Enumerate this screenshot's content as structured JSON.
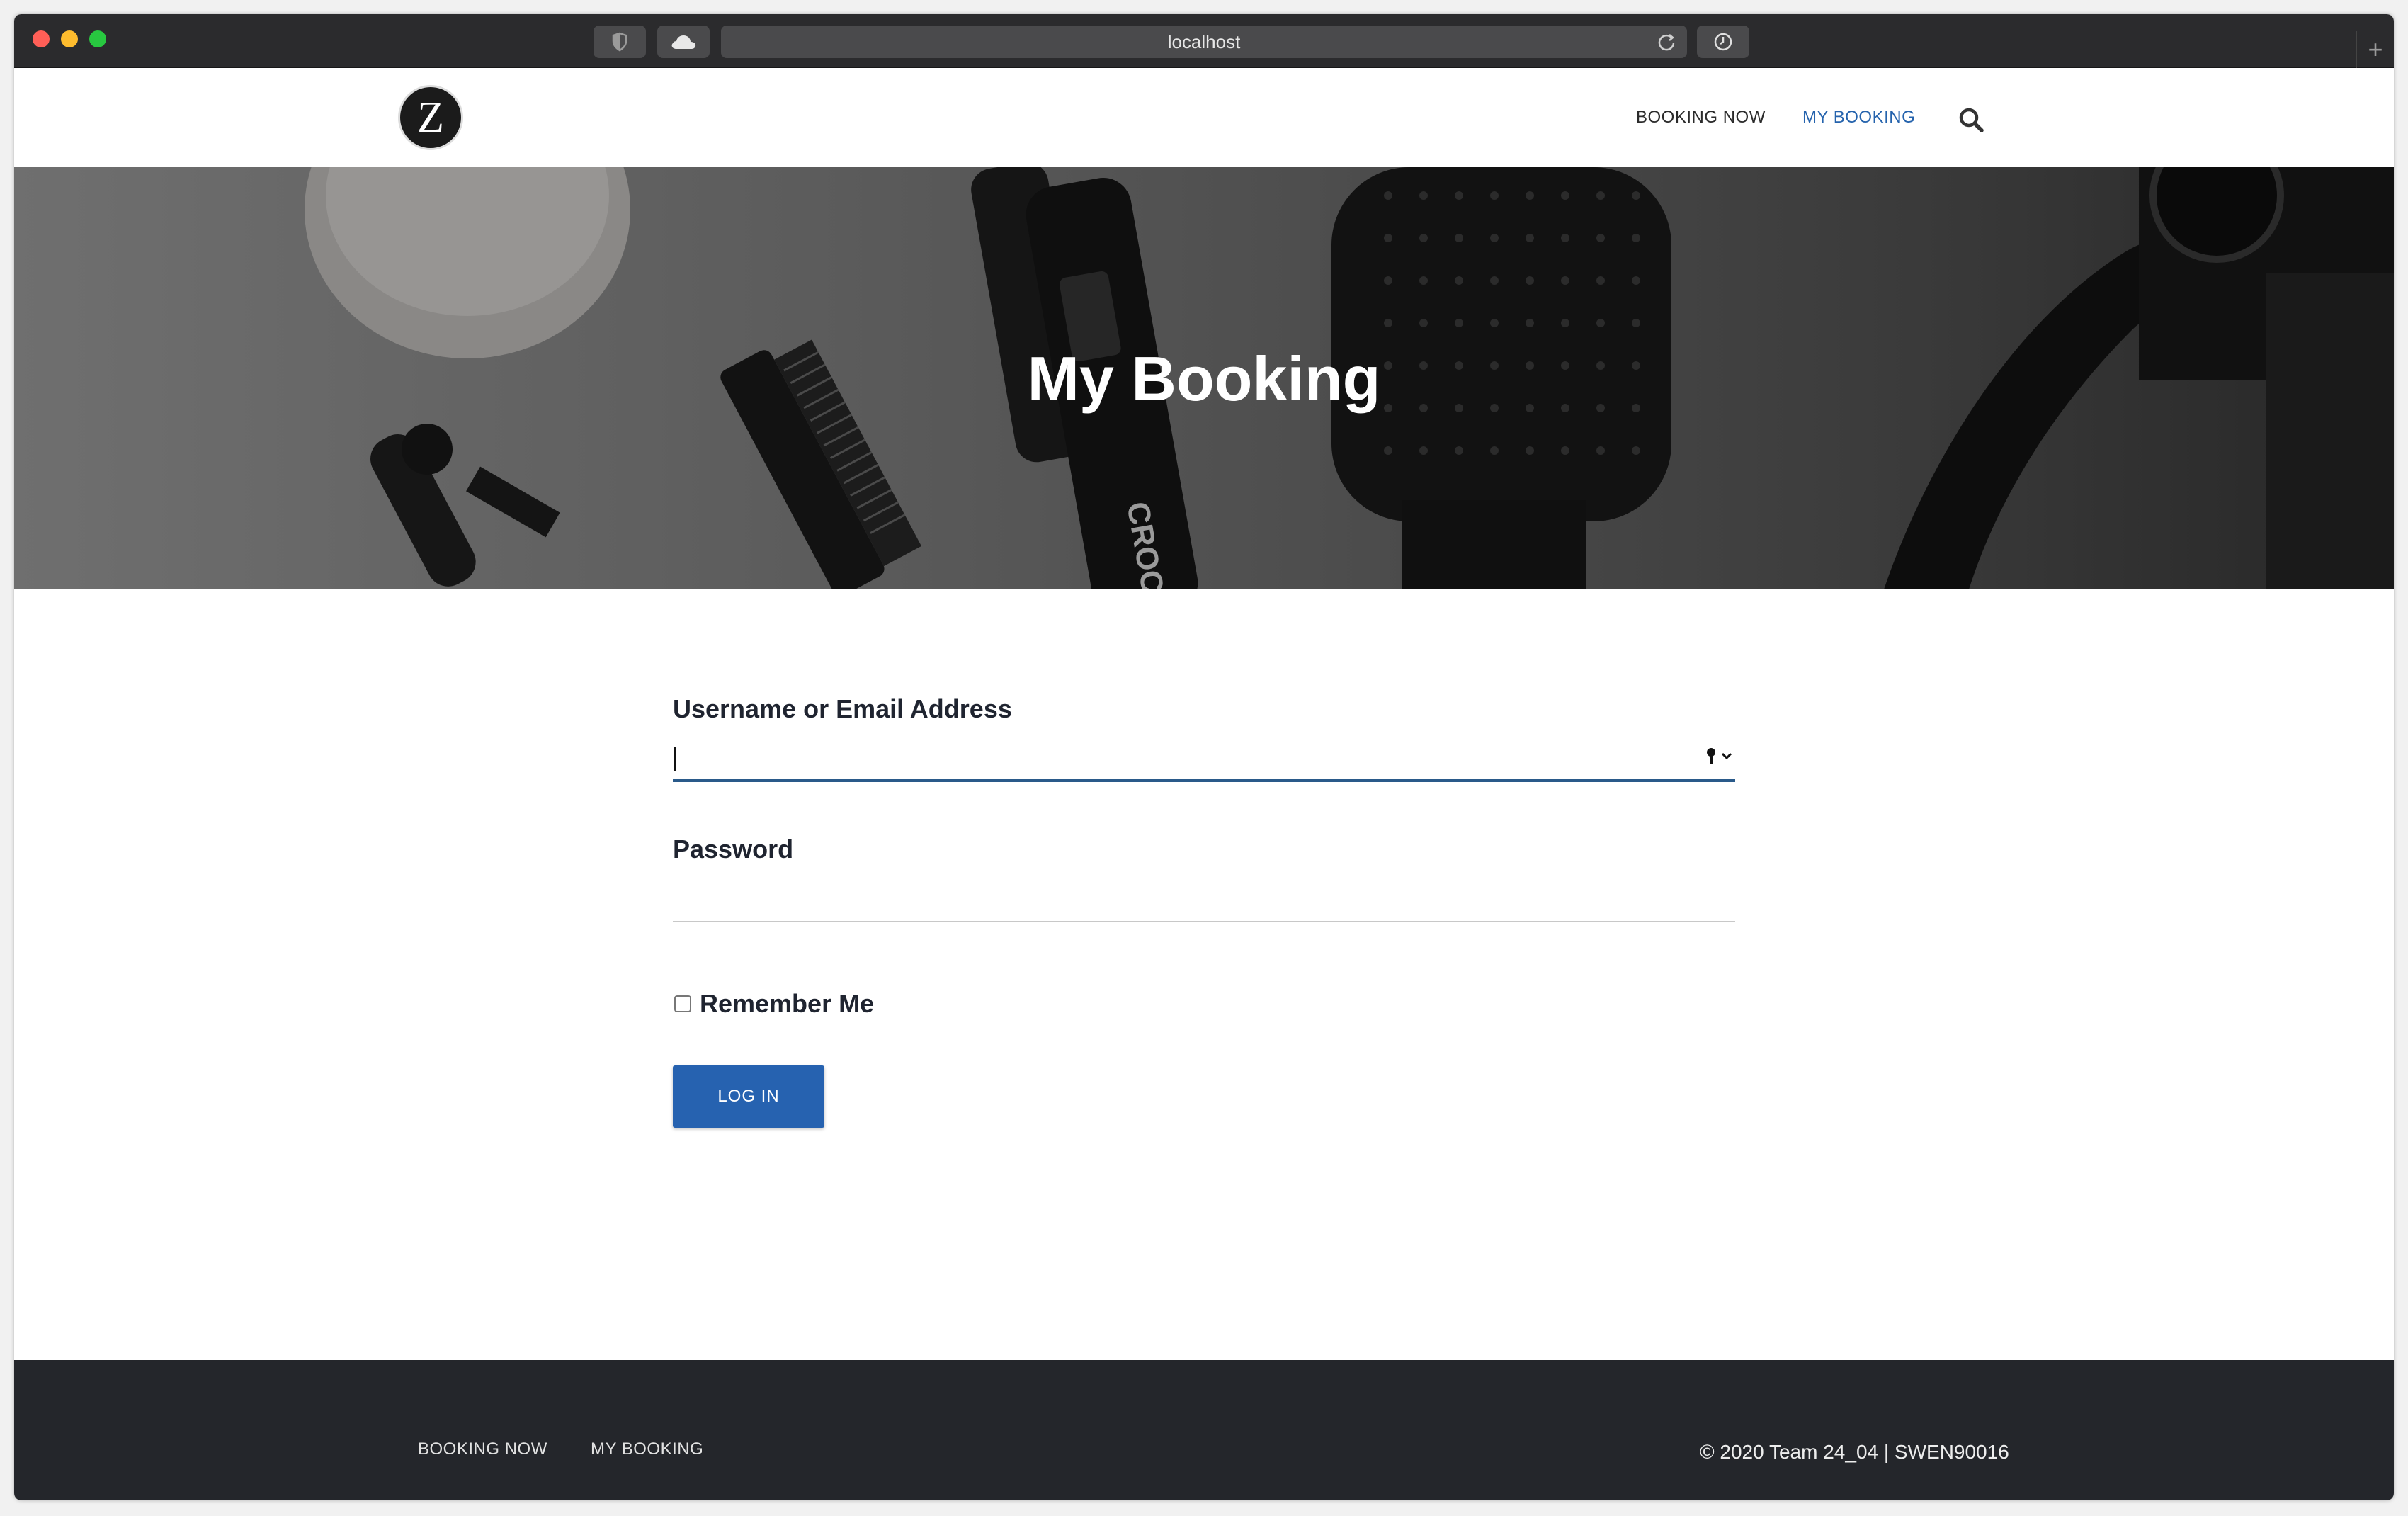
{
  "browser": {
    "url": "localhost"
  },
  "header": {
    "logo_letter": "Z",
    "nav": [
      {
        "label": "BOOKING NOW",
        "active": false
      },
      {
        "label": "MY BOOKING",
        "active": true
      }
    ]
  },
  "hero": {
    "title": "My Booking",
    "image_brand_text": "CROC"
  },
  "form": {
    "username_label": "Username or Email Address",
    "username_value": "",
    "password_label": "Password",
    "password_value": "",
    "remember_label": "Remember Me",
    "remember_checked": false,
    "login_label": "LOG IN"
  },
  "footer": {
    "links": [
      {
        "label": "BOOKING NOW"
      },
      {
        "label": "MY BOOKING"
      }
    ],
    "copyright": "© 2020 Team 24_04 | SWEN90016"
  },
  "colors": {
    "accent": "#2662b0",
    "active_nav": "#2563ad",
    "footer_bg": "#24262b",
    "chrome_bg": "#2b2b2d"
  }
}
